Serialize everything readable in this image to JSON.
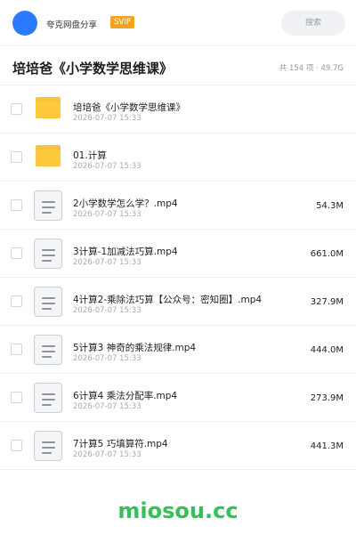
{
  "header": {
    "username": "夸克网盘分享",
    "badge": "SVIP",
    "search_placeholder": "搜索"
  },
  "folder": {
    "title": "培培爸《小学数学思维课》",
    "summary": "共 154 项 · 49.7G"
  },
  "files": [
    {
      "type": "folder",
      "name": "培培爸《小学数学思维课》",
      "date": "2026-07-07 15:33",
      "size": ""
    },
    {
      "type": "folder",
      "name": "01.计算",
      "date": "2026-07-07 15:33",
      "size": ""
    },
    {
      "type": "file",
      "name": "2小学数学怎么学？.mp4",
      "date": "2026-07-07 15:33",
      "size": "54.3M"
    },
    {
      "type": "file",
      "name": "3计算-1加减法巧算.mp4",
      "date": "2026-07-07 15:33",
      "size": "661.0M"
    },
    {
      "type": "file",
      "name": "4计算2-乘除法巧算【公众号：密知圈】.mp4",
      "date": "2026-07-07 15:33",
      "size": "327.9M"
    },
    {
      "type": "file",
      "name": "5计算3 神奇的乘法规律.mp4",
      "date": "2026-07-07 15:33",
      "size": "444.0M"
    },
    {
      "type": "file",
      "name": "6计算4 乘法分配率.mp4",
      "date": "2026-07-07 15:33",
      "size": "273.9M"
    },
    {
      "type": "file",
      "name": "7计算5 巧填算符.mp4",
      "date": "2026-07-07 15:33",
      "size": "441.3M"
    }
  ],
  "watermark": "miosou.cc",
  "colors": {
    "accent": "#2a7bff",
    "svip": "#f7a21c",
    "folder": "#ffc93e",
    "watermark": "#35c05a"
  }
}
